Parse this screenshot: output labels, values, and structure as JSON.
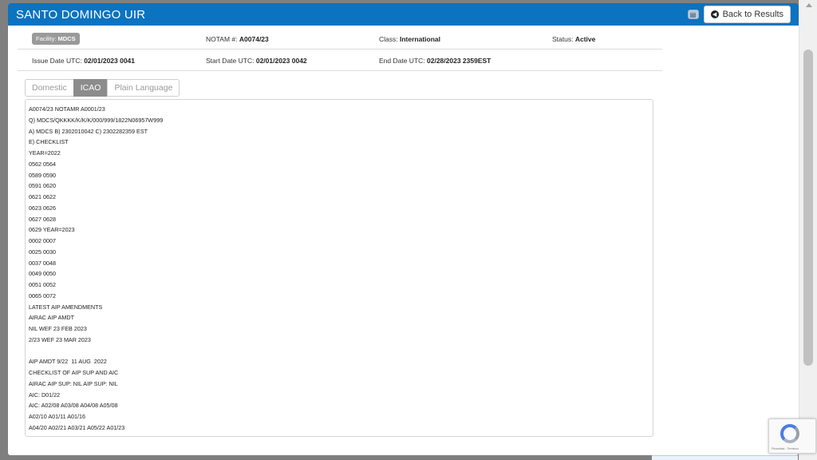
{
  "header": {
    "title": "SANTO DOMINGO UIR",
    "print_icon": "print-icon",
    "back_label": "Back to Results",
    "back_icon": "circle-arrow-left-icon",
    "color": "#0b73c0"
  },
  "info": {
    "facility_label": "Facility:",
    "facility_value": "MDCS",
    "notam_label": "NOTAM #:",
    "notam_value": "A0074/23",
    "class_label": "Class:",
    "class_value": "International",
    "status_label": "Status:",
    "status_value": "Active",
    "issue_label": "Issue Date UTC:",
    "issue_value": "02/01/2023 0041",
    "start_label": "Start Date UTC:",
    "start_value": "02/01/2023 0042",
    "end_label": "End Date UTC:",
    "end_value": "02/28/2023 2359EST"
  },
  "tabs": [
    {
      "label": "Domestic",
      "active": false
    },
    {
      "label": "ICAO",
      "active": true
    },
    {
      "label": "Plain Language",
      "active": false
    }
  ],
  "notam_lines": [
    "A0074/23 NOTAMR A0001/23",
    "Q) MDCS/QKKKK/K/K/K/000/999/1822N06957W999",
    "A) MDCS B) 2302010042 C) 2302282359 EST",
    "E) CHECKLIST",
    "YEAR=2022",
    "0562 0564",
    "0589 0590",
    "0591 0620",
    "0621 0622",
    "0623 0626",
    "0627 0628",
    "0629 YEAR=2023",
    "0002 0007",
    "0025 0030",
    "0037 0048",
    "0049 0050",
    "0051 0052",
    "0065 0072",
    "LATEST AIP AMENDMENTS",
    "AIRAC AIP AMDT",
    "NIL WEF 23 FEB 2023",
    "2/23 WEF 23 MAR 2023",
    "",
    "AIP AMDT 9/22  11 AUG  2022",
    "CHECKLIST OF AIP SUP AND AIC",
    "AIRAC AIP SUP: NIL AIP SUP: NIL",
    "AIC: D01/22",
    "AIC: A02/08 A03/08 A04/08 A05/08",
    "A02/10 A01/11 A01/16",
    "A04/20 A02/21 A03/21 A05/22 A01/23"
  ],
  "recaptcha": {
    "icon": "recaptcha-icon",
    "text": "Privacidad - Términos"
  }
}
